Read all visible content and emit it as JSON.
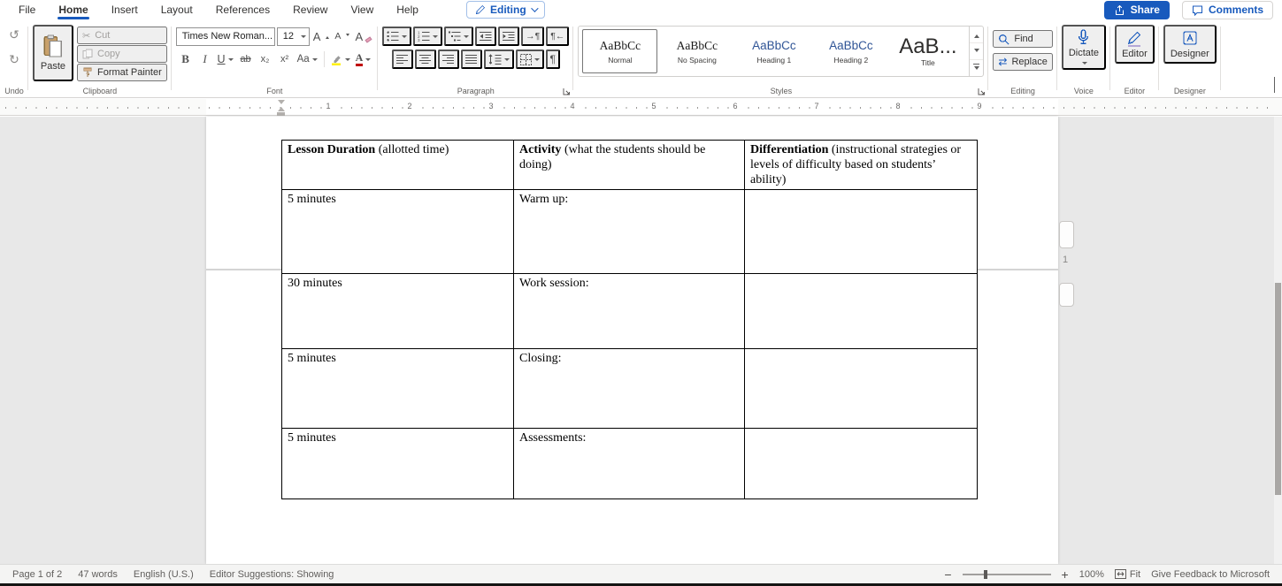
{
  "colors": {
    "accent": "#185abd",
    "highlight": "#fff000",
    "font_color": "#c00000"
  },
  "icons": {
    "undo": "↺",
    "redo": "↻",
    "cut": "✂",
    "pilcrow": "¶",
    "replace": "⇄",
    "ltr_text": "→¶",
    "rtl_text": "¶←",
    "bold": "B",
    "italic": "I",
    "underline": "U",
    "strikethrough": "ab",
    "subscript": "x₂",
    "superscript": "x²",
    "change_case": "Aa",
    "grow_font": "A",
    "shrink_font": "A",
    "clear_formatting": "A",
    "font_color": "A",
    "zoom_out": "−",
    "zoom_in": "+"
  },
  "menubar": {
    "tabs": [
      {
        "label": "File"
      },
      {
        "label": "Home"
      },
      {
        "label": "Insert"
      },
      {
        "label": "Layout"
      },
      {
        "label": "References"
      },
      {
        "label": "Review"
      },
      {
        "label": "View"
      },
      {
        "label": "Help"
      }
    ],
    "editing_button": {
      "label": "Editing"
    },
    "share_button": {
      "label": "Share"
    },
    "comments_button": {
      "label": "Comments"
    }
  },
  "ribbon": {
    "groups": {
      "undo": {
        "label": "Undo"
      },
      "clipboard": {
        "label": "Clipboard",
        "paste": "Paste",
        "cut": "Cut",
        "copy": "Copy",
        "format_painter": "Format Painter"
      },
      "font": {
        "label": "Font",
        "family": "Times New Roman...",
        "size": "12"
      },
      "paragraph": {
        "label": "Paragraph"
      },
      "styles": {
        "label": "Styles",
        "items": [
          {
            "preview": "AaBbCc",
            "name": "Normal"
          },
          {
            "preview": "AaBbCc",
            "name": "No Spacing"
          },
          {
            "preview": "AaBbCc",
            "name": "Heading 1"
          },
          {
            "preview": "AaBbCc",
            "name": "Heading 2"
          },
          {
            "preview": "AaB...",
            "name": "Title"
          }
        ]
      },
      "editing": {
        "label": "Editing",
        "find": "Find",
        "replace": "Replace"
      },
      "voice": {
        "label": "Voice",
        "dictate": "Dictate"
      },
      "editor": {
        "label": "Editor",
        "button": "Editor"
      },
      "designer": {
        "label": "Designer",
        "button": "Designer"
      }
    }
  },
  "ruler": {
    "numbers": [
      "1",
      "2",
      "3",
      "4",
      "5",
      "6",
      "7",
      "8",
      "9"
    ]
  },
  "document": {
    "page_break_marker": "1",
    "table": {
      "headers": [
        {
          "title": "Lesson Duration",
          "desc": " (allotted time)"
        },
        {
          "title": "Activity",
          "desc": " (what the students should be doing)"
        },
        {
          "title": "Differentiation",
          "desc": " (instructional strategies or levels of difficulty based on students’ ability)"
        }
      ],
      "rows": [
        {
          "duration": "5 minutes",
          "activity": "Warm up:",
          "differentiation": ""
        },
        {
          "duration": "30 minutes",
          "activity": "Work session:",
          "differentiation": ""
        },
        {
          "duration": "5 minutes",
          "activity": "Closing:",
          "differentiation": ""
        },
        {
          "duration": "5 minutes",
          "activity": "Assessments:",
          "differentiation": ""
        }
      ]
    }
  },
  "statusbar": {
    "page_info": "Page 1 of 2",
    "word_count": "47 words",
    "language": "English (U.S.)",
    "editor_suggestions": "Editor Suggestions: Showing",
    "zoom_level": "100%",
    "fit_label": "Fit",
    "feedback": "Give Feedback to Microsoft"
  }
}
